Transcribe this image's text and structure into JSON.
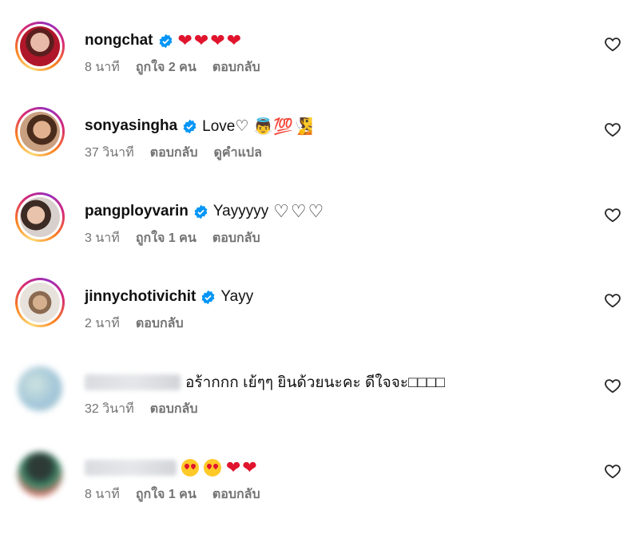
{
  "comments": [
    {
      "username": "nongchat",
      "verified": true,
      "text": "❤❤❤❤",
      "time": "8 นาที",
      "likes": "ถูกใจ 2 คน",
      "reply": "ตอบกลับ",
      "extra": ""
    },
    {
      "username": "sonyasingha",
      "verified": true,
      "text": "Love♡",
      "emojis": "👼💯🧏",
      "time": "37 วินาที",
      "likes": "",
      "reply": "ตอบกลับ",
      "extra": "ดูคำแปล"
    },
    {
      "username": "pangployvarin",
      "verified": true,
      "text": "Yayyyyy",
      "emojis": "♡♡♡",
      "time": "3 นาที",
      "likes": "ถูกใจ 1 คน",
      "reply": "ตอบกลับ",
      "extra": ""
    },
    {
      "username": "jinnychotivichit",
      "verified": true,
      "text": "Yayy",
      "time": "2 นาที",
      "likes": "",
      "reply": "ตอบกลับ",
      "extra": ""
    },
    {
      "username": "",
      "verified": false,
      "text": "อร้ากกก เย้ๆๆ ยินด้วยนะคะ ดีใจจะ□□□□",
      "time": "32 วินาที",
      "likes": "",
      "reply": "ตอบกลับ",
      "extra": ""
    },
    {
      "username": "",
      "verified": false,
      "text": "❤❤",
      "time": "8 นาที",
      "likes": "ถูกใจ 1 คน",
      "reply": "ตอบกลับ",
      "extra": ""
    }
  ],
  "icons": {
    "verified_color": "#0095f6",
    "heart_outline": "heart-outline-icon"
  }
}
